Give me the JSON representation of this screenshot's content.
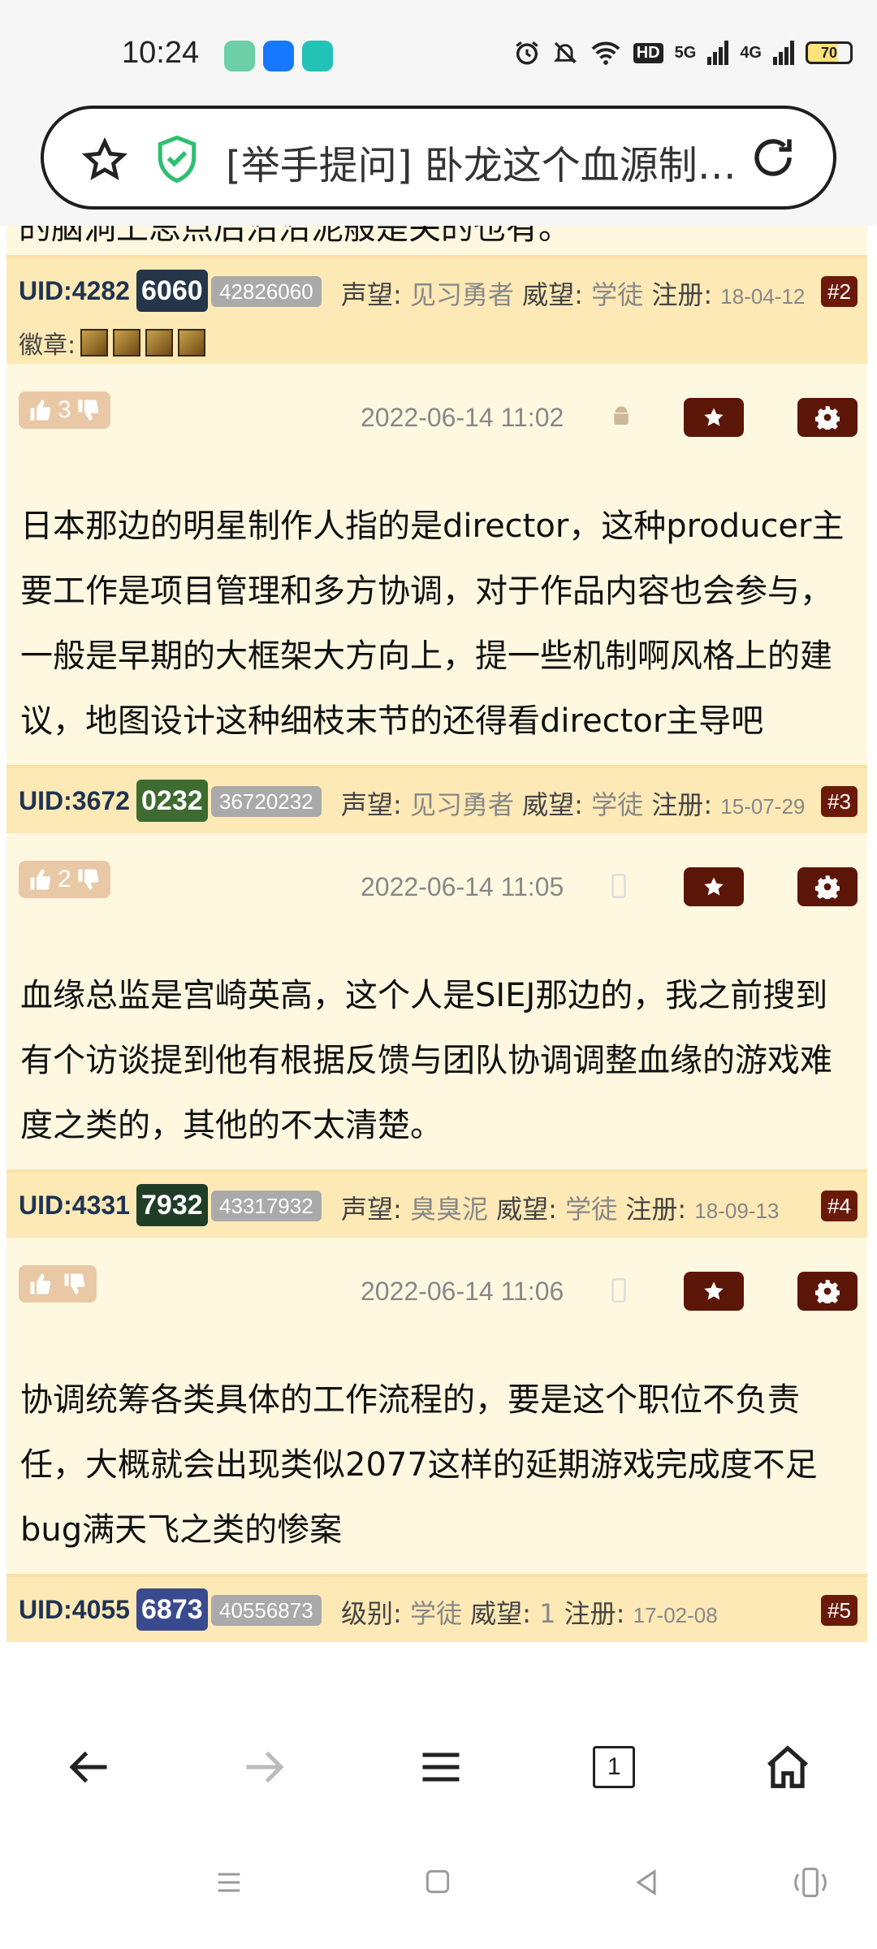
{
  "status": {
    "time": "10:24",
    "network_hd": "HD",
    "net_5g": "5G",
    "net_4g": "4G",
    "battery": "70"
  },
  "browser": {
    "page_title": "[举手提问] 卧龙这个血源制…"
  },
  "posts": [
    {
      "partial_text": "的脑洞上思点后沿沿泥般是关的也有。",
      "uid_prefix": "UID:4282",
      "uid_badge": "6060",
      "uid_badge_color": "#25364a",
      "uid_number": "42826060",
      "info1_label": "声望:",
      "info1_value": "见习勇者",
      "info2_label": "威望:",
      "info2_value": "学徒",
      "reg_label": "注册:",
      "reg_date": "18-04-12",
      "floor": "#2",
      "badges_label": "徽章:",
      "votes": "3",
      "timestamp": "2022-06-14 11:02",
      "device": "android-icon",
      "text": "日本那边的明星制作人指的是director，这种producer主要工作是项目管理和多方协调，对于作品内容也会参与，一般是早期的大框架大方向上，提一些机制啊风格上的建议，地图设计这种细枝末节的还得看director主导吧"
    },
    {
      "uid_prefix": "UID:3672",
      "uid_badge": "0232",
      "uid_badge_color": "#3e6b2f",
      "uid_number": "36720232",
      "info1_label": "声望:",
      "info1_value": "见习勇者",
      "info2_label": "威望:",
      "info2_value": "学徒",
      "reg_label": "注册:",
      "reg_date": "15-07-29",
      "floor": "#3",
      "votes": "2",
      "timestamp": "2022-06-14 11:05",
      "device": "phone-icon",
      "text": "血缘总监是宫崎英高，这个人是SIEJ那边的，我之前搜到有个访谈提到他有根据反馈与团队协调调整血缘的游戏难度之类的，其他的不太清楚。"
    },
    {
      "uid_prefix": "UID:4331",
      "uid_badge": "7932",
      "uid_badge_color": "#1f3d27",
      "uid_number": "43317932",
      "info1_label": "声望:",
      "info1_value": "臭臭泥",
      "info2_label": "威望:",
      "info2_value": "学徒",
      "reg_label": "注册:",
      "reg_date": "18-09-13",
      "floor": "#4",
      "votes": "",
      "timestamp": "2022-06-14 11:06",
      "device": "phone-icon",
      "text": "协调统筹各类具体的工作流程的，要是这个职位不负责任，大概就会出现类似2077这样的延期游戏完成度不足bug满天飞之类的惨案"
    },
    {
      "uid_prefix": "UID:4055",
      "uid_badge": "6873",
      "uid_badge_color": "#3a4a8e",
      "uid_number": "40556873",
      "info1_label": "级别:",
      "info1_value": "学徒",
      "info2_label": "威望:",
      "info2_value": "1",
      "reg_label": "注册:",
      "reg_date": "17-02-08",
      "floor": "#5"
    }
  ],
  "nav": {
    "tab_count": "1"
  }
}
